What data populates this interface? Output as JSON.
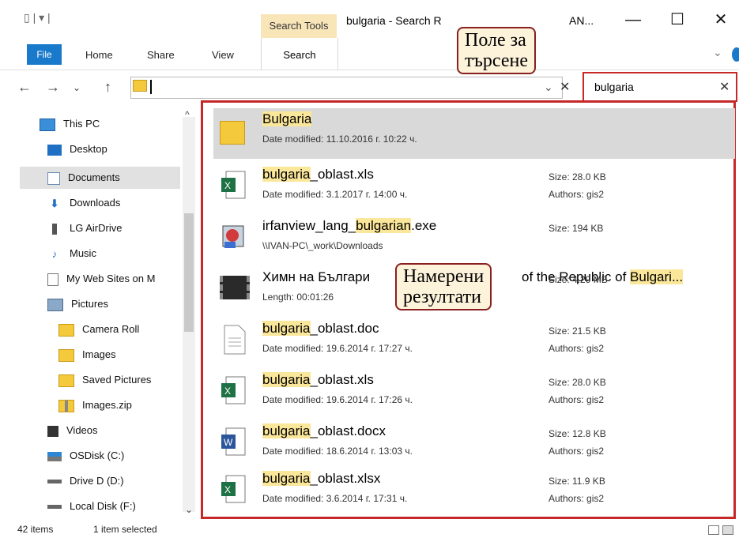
{
  "window": {
    "qat": "▯ | ▾ |",
    "search_tools": "Search Tools",
    "title": "bulgaria - Search R",
    "title_tail": "AN...",
    "minimize": "—",
    "maximize": "☐",
    "close": "✕"
  },
  "ribbon": {
    "tabs": [
      "File",
      "Home",
      "Share",
      "View",
      "Search"
    ],
    "expand": "⌄"
  },
  "nav": {
    "back": "←",
    "forward": "→",
    "recent": "⌄",
    "up": "↑"
  },
  "address": {
    "value": "",
    "dropdown": "⌄",
    "clear": "✕"
  },
  "search": {
    "value": "bulgaria",
    "clear": "✕"
  },
  "callouts": {
    "search_field": [
      "Поле за",
      "търсене"
    ],
    "results_found": [
      "Намерени",
      "резултати"
    ]
  },
  "sidebar": {
    "items": [
      {
        "label": "This PC",
        "icon": "monitor-icon"
      },
      {
        "label": "Desktop",
        "icon": "desktop-icon"
      },
      {
        "label": "Documents",
        "icon": "documents-icon",
        "selected": true
      },
      {
        "label": "Downloads",
        "icon": "download-arrow-icon"
      },
      {
        "label": "LG AirDrive",
        "icon": "drive-icon"
      },
      {
        "label": "Music",
        "icon": "music-note-icon"
      },
      {
        "label": "My Web Sites on M",
        "icon": "page-icon"
      },
      {
        "label": "Pictures",
        "icon": "pictures-icon"
      },
      {
        "label": "Camera Roll",
        "icon": "folder-icon"
      },
      {
        "label": "Images",
        "icon": "folder-icon"
      },
      {
        "label": "Saved Pictures",
        "icon": "folder-icon"
      },
      {
        "label": "Images.zip",
        "icon": "zip-folder-icon"
      },
      {
        "label": "Videos",
        "icon": "video-icon"
      },
      {
        "label": "OSDisk (C:)",
        "icon": "os-disk-icon"
      },
      {
        "label": "Drive D (D:)",
        "icon": "disk-icon"
      },
      {
        "label": "Local Disk (F:)",
        "icon": "disk-icon"
      }
    ],
    "scroll_up": "^",
    "scroll_down": "⌄"
  },
  "results": [
    {
      "pre": "",
      "hl": "Bulgaria",
      "post": "",
      "sub": "Date modified: 11.10.2016 г. 10:22 ч.",
      "size": "",
      "authors": "",
      "icon": "folder-icon",
      "selected": true
    },
    {
      "pre": "",
      "hl": "bulgaria",
      "post": "_oblast.xls",
      "sub": "Date modified: 3.1.2017 г. 14:00 ч.",
      "size": "Size: 28.0 KB",
      "authors": "Authors: gis2",
      "icon": "excel-file-icon"
    },
    {
      "pre": "irfanview_lang_",
      "hl": "bulgarian",
      "post": ".exe",
      "sub": "\\\\IVAN-PC\\_work\\Downloads",
      "size": "Size: 194 KB",
      "authors": "",
      "icon": "exe-file-icon"
    },
    {
      "pre": "Химн на Българи",
      "hl": "",
      "post": "",
      "tail_pre": "of the Republic of ",
      "tail_hl": "Bulgari...",
      "sub": "Length: 00:01:26",
      "size": "Size: 4.29 MB",
      "authors": "",
      "icon": "video-file-icon"
    },
    {
      "pre": "",
      "hl": "bulgaria",
      "post": "_oblast.doc",
      "sub": "Date modified: 19.6.2014 г. 17:27 ч.",
      "size": "Size: 21.5 KB",
      "authors": "Authors: gis2",
      "icon": "doc-file-icon"
    },
    {
      "pre": "",
      "hl": "bulgaria",
      "post": "_oblast.xls",
      "sub": "Date modified: 19.6.2014 г. 17:26 ч.",
      "size": "Size: 28.0 KB",
      "authors": "Authors: gis2",
      "icon": "excel-file-icon"
    },
    {
      "pre": "",
      "hl": "bulgaria",
      "post": "_oblast.docx",
      "sub": "Date modified: 18.6.2014 г. 13:03 ч.",
      "size": "Size: 12.8 KB",
      "authors": "Authors: gis2",
      "icon": "word-file-icon"
    },
    {
      "pre": "",
      "hl": "bulgaria",
      "post": "_oblast.xlsx",
      "sub": "Date modified: 3.6.2014 г. 17:31 ч.",
      "size": "Size: 11.9 KB",
      "authors": "Authors: gis2",
      "icon": "excel-file-icon"
    }
  ],
  "status": {
    "items": "42 items",
    "selected": "1 item selected"
  },
  "colors": {
    "accent": "#1979ca",
    "highlight": "#fbe79a",
    "annotation_border": "#c62828",
    "search_tools": "#f8e6b9"
  }
}
